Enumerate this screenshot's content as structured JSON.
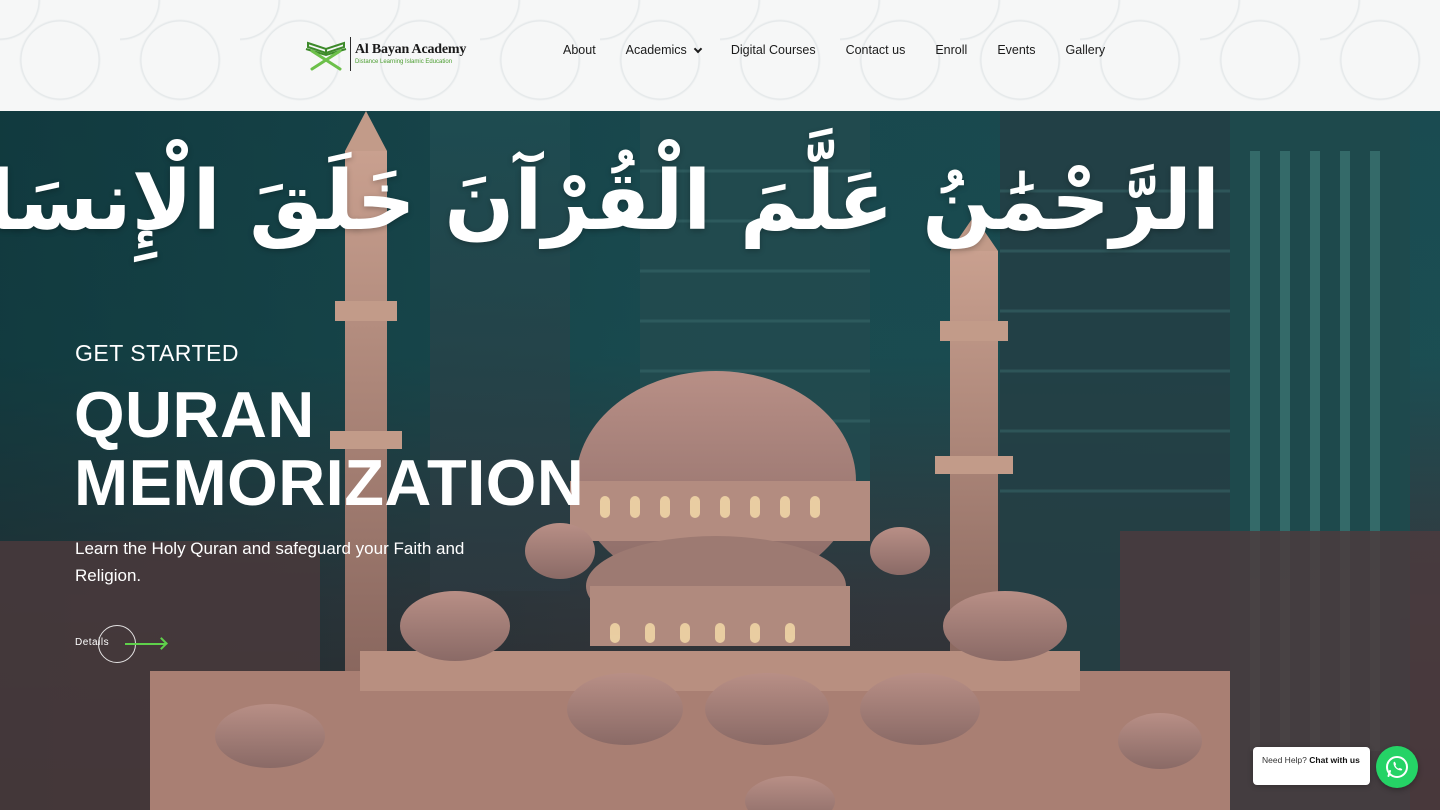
{
  "brand": {
    "name": "Al Bayan Academy",
    "tagline": "Distance Learning Islamic Education",
    "accent_color": "#4a9d2f"
  },
  "nav": {
    "items": [
      {
        "label": "About"
      },
      {
        "label": "Academics",
        "has_dropdown": true
      },
      {
        "label": "Digital Courses"
      },
      {
        "label": "Contact us"
      },
      {
        "label": "Enroll"
      },
      {
        "label": "Events"
      },
      {
        "label": "Gallery"
      }
    ]
  },
  "hero": {
    "calligraphy": "الرَّحْمَٰنُ عَلَّمَ الْقُرْآنَ خَلَقَ الْإِنسَانَ عَلَّمَهُ الْبَيَانَ",
    "eyebrow": "GET STARTED",
    "headline_line1": "QURAN",
    "headline_line2": "MEMORIZATION",
    "subtext": "Learn the Holy Quran and safeguard your Faith and Religion.",
    "cta_label": "Details",
    "cta_arrow_color": "#5fd14b"
  },
  "chat": {
    "prefix": "Need Help?",
    "action": "Chat with us",
    "icon": "whatsapp-icon",
    "button_color": "#25d366"
  }
}
